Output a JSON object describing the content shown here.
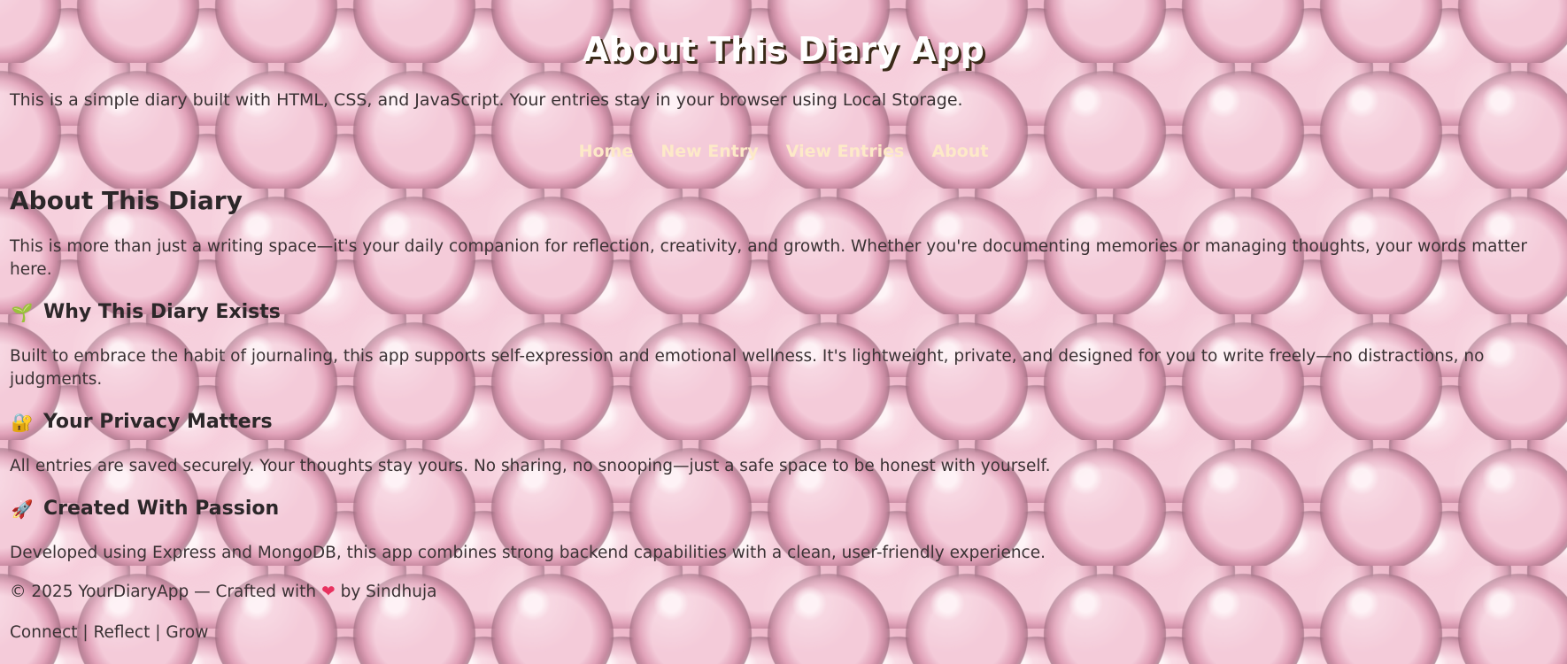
{
  "header": {
    "title": "About This Diary App",
    "intro": "This is a simple diary built with HTML, CSS, and JavaScript. Your entries stay in your browser using Local Storage."
  },
  "nav": {
    "items": [
      {
        "label": "Home"
      },
      {
        "label": "New Entry"
      },
      {
        "label": "View Entries"
      },
      {
        "label": "About"
      }
    ]
  },
  "main": {
    "heading": "About This Diary",
    "lead": "This is more than just a writing space—it's your daily companion for reflection, creativity, and growth. Whether you're documenting memories or managing thoughts, your words matter here.",
    "sections": [
      {
        "icon": "seedling-icon",
        "emoji": "🌱",
        "title": "Why This Diary Exists",
        "body": "Built to embrace the habit of journaling, this app supports self-expression and emotional wellness. It's lightweight, private, and designed for you to write freely—no distractions, no judgments."
      },
      {
        "icon": "lock-icon",
        "emoji": "🔐",
        "title": "Your Privacy Matters",
        "body": "All entries are saved securely. Your thoughts stay yours. No sharing, no snooping—just a safe space to be honest with yourself."
      },
      {
        "icon": "rocket-icon",
        "emoji": "🚀",
        "title": "Created With Passion",
        "body": "Developed using Express and MongoDB, this app combines strong backend capabilities with a clean, user-friendly experience."
      }
    ]
  },
  "footer": {
    "copyright_prefix": "© 2025 YourDiaryApp — Crafted with",
    "heart_icon": "heart-icon",
    "copyright_suffix": "by Sindhuja",
    "tagline": "Connect | Reflect | Grow"
  },
  "colors": {
    "nav_link": "#fde9c8",
    "title": "#ffffff",
    "title_shadow": "#3a2a18",
    "heart": "#e8315f",
    "text": "#2f2a2c"
  }
}
